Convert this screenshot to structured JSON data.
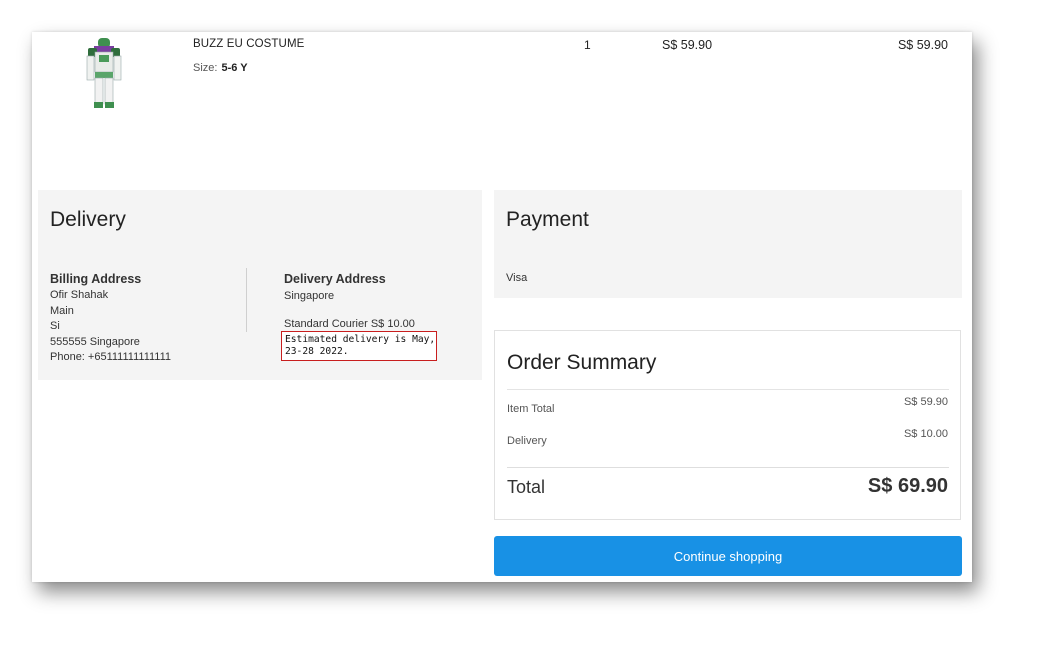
{
  "product": {
    "name": "BUZZ EU COSTUME",
    "size_label": "Size:",
    "size_value": "5-6 Y",
    "quantity": "1",
    "unit_price": "S$ 59.90",
    "line_total": "S$ 59.90",
    "image_icon": "costume-image"
  },
  "delivery": {
    "title": "Delivery",
    "billing": {
      "title": "Billing Address",
      "lines": [
        "Ofir Shahak",
        "Main",
        "Si",
        "555555 Singapore",
        "Phone: +65111111111111"
      ]
    },
    "delivery_address": {
      "title": "Delivery Address",
      "country": "Singapore",
      "courier": "Standard Courier S$ 10.00",
      "estimate": "Estimated delivery is May, 23-28 2022."
    }
  },
  "payment": {
    "title": "Payment",
    "method": "Visa"
  },
  "summary": {
    "title": "Order Summary",
    "item_total_label": "Item Total",
    "item_total_value": "S$ 59.90",
    "delivery_label": "Delivery",
    "delivery_value": "S$ 10.00",
    "total_label": "Total",
    "total_value": "S$ 69.90"
  },
  "actions": {
    "continue_label": "Continue shopping"
  },
  "colors": {
    "accent": "#1891e5",
    "highlight_border": "#c81e1e",
    "panel_bg": "#f4f4f4"
  }
}
